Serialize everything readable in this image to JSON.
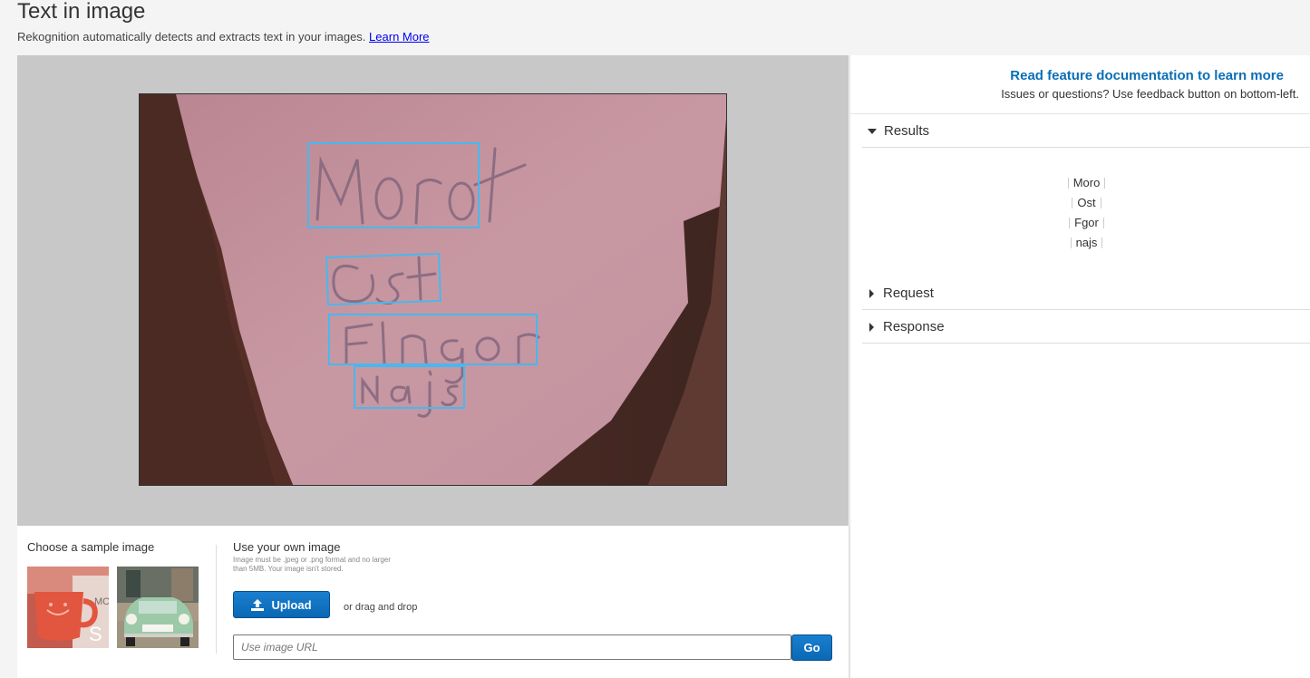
{
  "header": {
    "title": "Text in image",
    "subtitle": "Rekognition automatically detects and extracts text in your images.",
    "learn_more": "Learn More"
  },
  "image_panel": {
    "detected_boxes": [
      "Moro",
      "Ost",
      "Fgor",
      "najs"
    ]
  },
  "samples": {
    "heading": "Choose a sample image"
  },
  "own_image": {
    "heading": "Use your own image",
    "note": "Image must be .jpeg or .png format and no larger than 5MB. Your image isn't stored.",
    "upload_label": "Upload",
    "drag_text": "or drag and drop",
    "url_placeholder": "Use image URL",
    "go_label": "Go"
  },
  "right_panel": {
    "doc_link": "Read feature documentation to learn more",
    "issues_text": "Issues or questions? Use feedback button on bottom-left.",
    "sections": {
      "results": "Results",
      "request": "Request",
      "response": "Response"
    },
    "results": [
      "Moro",
      "Ost",
      "Fgor",
      "najs"
    ]
  },
  "colors": {
    "accent_blue": "#0a6fb6",
    "bbox": "#47b8f0",
    "stage_bg": "#c8c8c8"
  }
}
